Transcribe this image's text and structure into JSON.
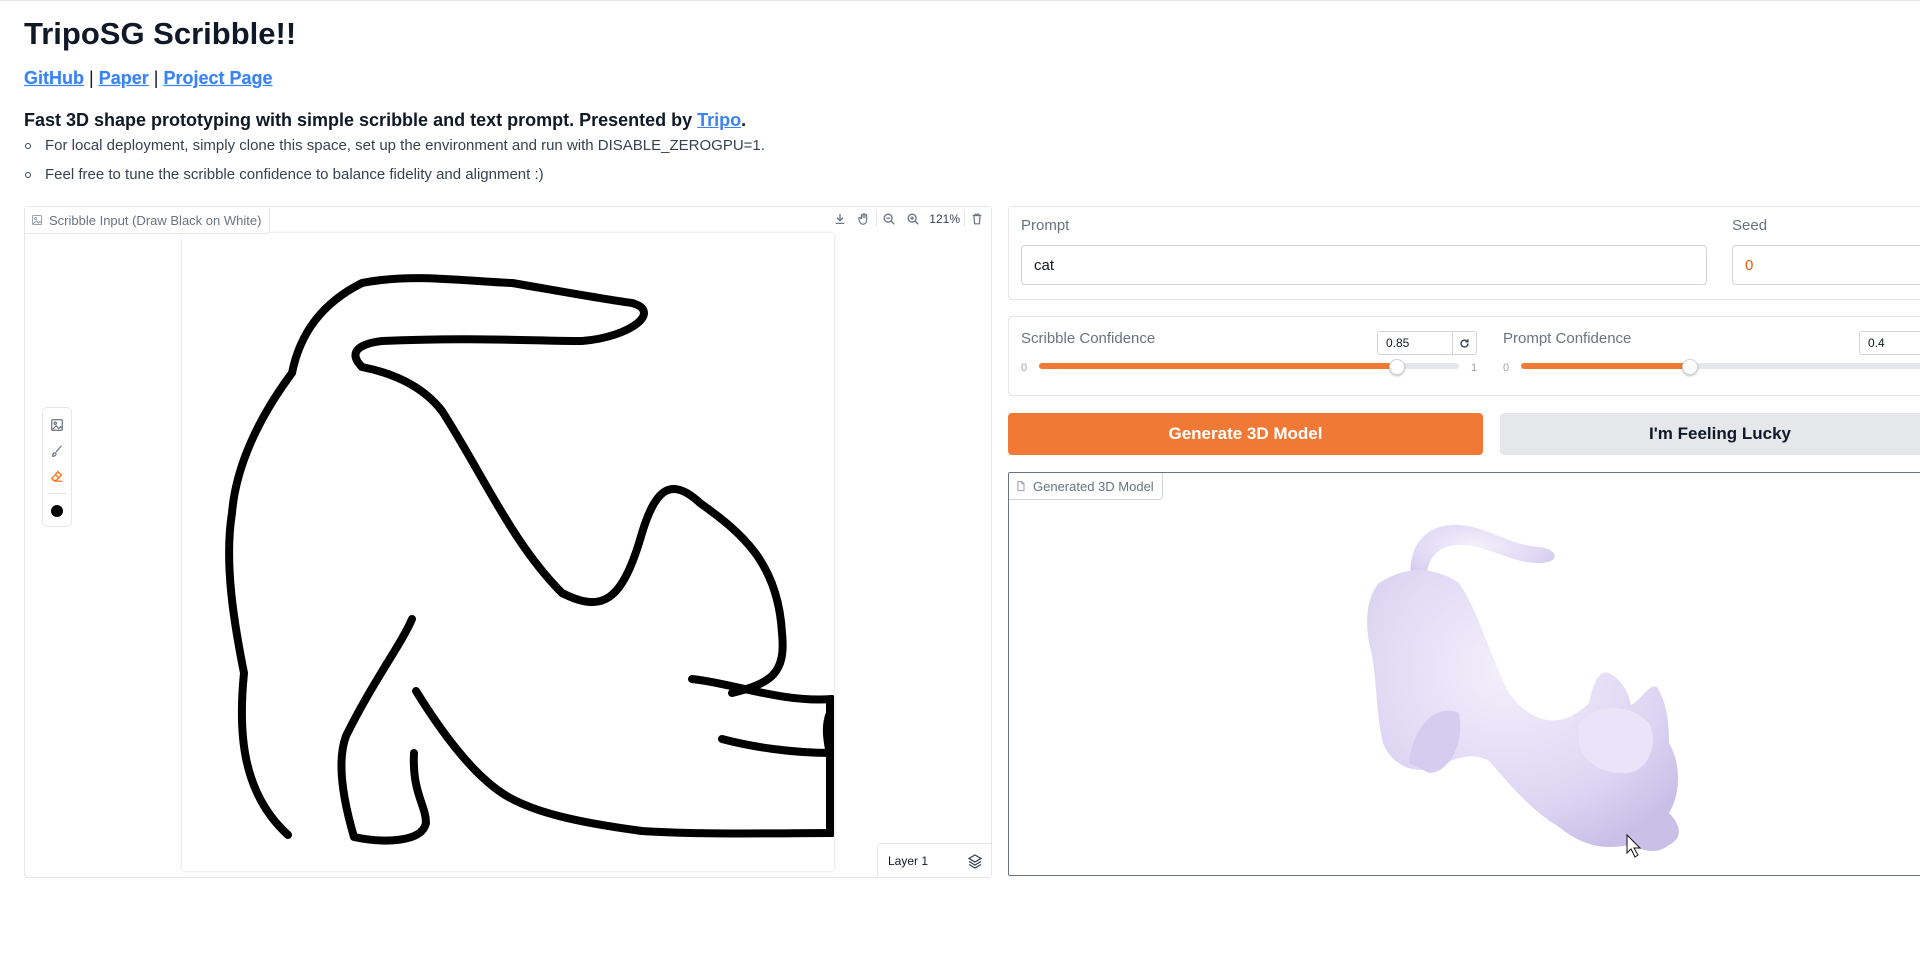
{
  "app": {
    "title": "TripoSG Scribble!!",
    "links": [
      "GitHub",
      "Paper",
      "Project Page"
    ],
    "link_separator": "|",
    "intro_text": "Fast 3D shape prototyping with simple scribble and text prompt. Presented by ",
    "intro_link": "Tripo",
    "intro_end": ".",
    "bullets": [
      "For local deployment, simply clone this space, set up the environment and run with DISABLE_ZEROGPU=1.",
      "Feel free to tune the scribble confidence to balance fidelity and alignment :)"
    ]
  },
  "scribble": {
    "label": "Scribble Input (Draw Black on White)",
    "zoom": "121%",
    "layer": "Layer 1",
    "brush_color": "#000000",
    "tools": [
      "image-icon",
      "brush-icon",
      "eraser-icon"
    ],
    "toolbar": [
      "download-icon",
      "pan-icon",
      "zoom-out-icon",
      "zoom-in-icon",
      "trash-icon"
    ]
  },
  "inputs": {
    "prompt_label": "Prompt",
    "prompt_value": "cat",
    "seed_label": "Seed",
    "seed_value": "0"
  },
  "sliders": {
    "scribble": {
      "label": "Scribble Confidence",
      "value": "0.85",
      "min": "0",
      "max": "1",
      "fraction": 0.85
    },
    "prompt": {
      "label": "Prompt Confidence",
      "value": "0.4",
      "min": "0",
      "fraction": 0.4
    }
  },
  "buttons": {
    "generate": "Generate 3D Model",
    "lucky": "I'm Feeling Lucky"
  },
  "model": {
    "label": "Generated 3D Model"
  },
  "colors": {
    "accent": "#f07a35",
    "link": "#3b82f6",
    "model_tint": "#ddd6f3"
  }
}
